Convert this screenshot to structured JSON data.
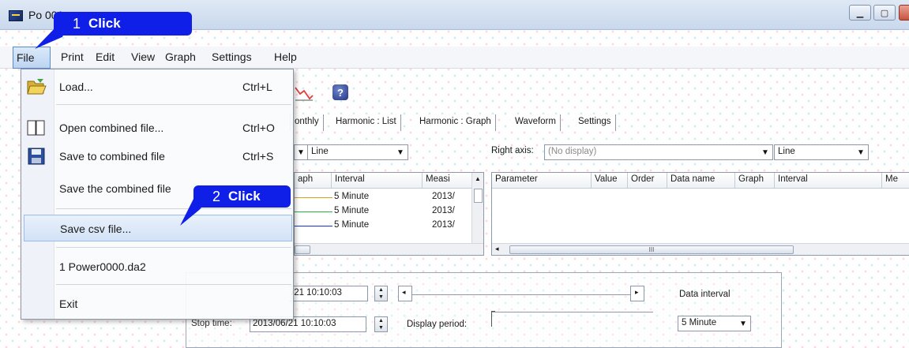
{
  "window": {
    "title": "Po          001"
  },
  "callouts": [
    {
      "num": "1",
      "text": "Click"
    },
    {
      "num": "2",
      "text": "Click"
    }
  ],
  "menubar": {
    "items": [
      "File",
      "Print",
      "Edit",
      "View",
      "Graph",
      "Settings",
      "Help"
    ]
  },
  "file_menu": {
    "load": {
      "label": "Load...",
      "shortcut": "Ctrl+L"
    },
    "open_combined": {
      "label": "Open combined file...",
      "shortcut": "Ctrl+O"
    },
    "save_combined": {
      "label": "Save to combined file",
      "shortcut": "Ctrl+S"
    },
    "save_the_combined": {
      "label": "Save the combined file"
    },
    "save_csv": {
      "label": "Save csv file..."
    },
    "recent": {
      "label": "1 Power0000.da2"
    },
    "exit": {
      "label": "Exit"
    }
  },
  "tabs": [
    "onthly",
    "Harmonic : List",
    "Harmonic : Graph",
    "Waveform",
    "Settings"
  ],
  "left_axis": {
    "line_style": "Line"
  },
  "right_axis": {
    "label": "Right axis:",
    "value": "(No display)",
    "line_style": "Line"
  },
  "left_table": {
    "columns": [
      "aph",
      "Interval",
      "Measi"
    ],
    "rows": [
      {
        "interval": "5 Minute",
        "meas": "2013/",
        "line_color": "#d9a21c"
      },
      {
        "interval": "5 Minute",
        "meas": "2013/",
        "line_color": "#22b83a"
      },
      {
        "interval": "5 Minute",
        "meas": "2013/",
        "line_color": "#1730e0"
      }
    ]
  },
  "right_table": {
    "columns": [
      "Parameter",
      "Value",
      "Order",
      "Data name",
      "Graph",
      "Interval",
      "Me"
    ],
    "scroll_thumb": "III"
  },
  "time_panel": {
    "start_time": "/21  10:10:03",
    "stop_label": "Stop time:",
    "stop_time": "2013/06/21  10:10:03",
    "display_period_label": "Display period:",
    "data_interval_label": "Data interval",
    "data_interval_value": "5 Minute"
  }
}
